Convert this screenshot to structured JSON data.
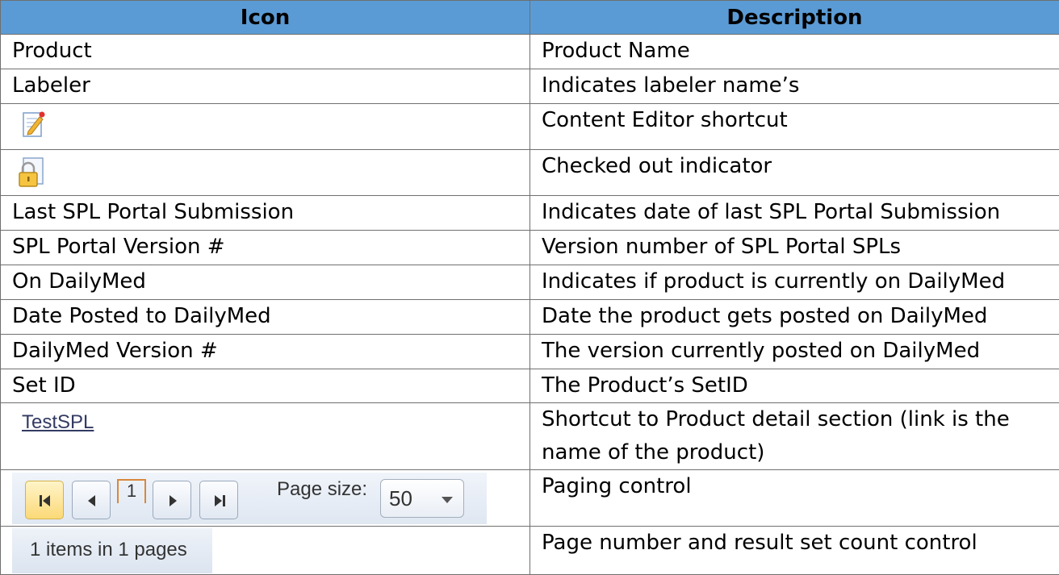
{
  "header": {
    "col1": "Icon",
    "col2": "Description"
  },
  "rows": [
    {
      "icon_text": "Product",
      "description": "Product Name"
    },
    {
      "icon_text": "Labeler",
      "description": "Indicates labeler name’s"
    },
    {
      "icon": "content-editor-icon",
      "description": "Content Editor shortcut"
    },
    {
      "icon": "checked-out-lock-icon",
      "description": "Checked out indicator"
    },
    {
      "icon_text": "Last SPL Portal Submission",
      "description": "Indicates date of last SPL Portal Submission"
    },
    {
      "icon_text": "SPL Portal Version #",
      "description": "Version number of SPL Portal SPLs"
    },
    {
      "icon_text": "On DailyMed",
      "description": "Indicates if product is currently on DailyMed"
    },
    {
      "icon_text": "Date Posted to DailyMed",
      "description": "Date the product gets posted on DailyMed"
    },
    {
      "icon_text": "DailyMed Version #",
      "description": "The version currently posted on DailyMed"
    },
    {
      "icon_text": "Set ID",
      "description": "The Product’s SetID"
    },
    {
      "link_text": "TestSPL",
      "description": "Shortcut to Product detail section (link is the name of the product)"
    },
    {
      "pager": {
        "current_page": "1",
        "page_size_label": "Page size:",
        "page_size_value": "50"
      },
      "description": "Paging control"
    },
    {
      "count_text": "1 items in 1 pages",
      "description": "Page number and result set count control"
    }
  ],
  "colors": {
    "header_bg": "#5b9bd5",
    "border": "#6f6f6f",
    "link": "#333a63"
  }
}
